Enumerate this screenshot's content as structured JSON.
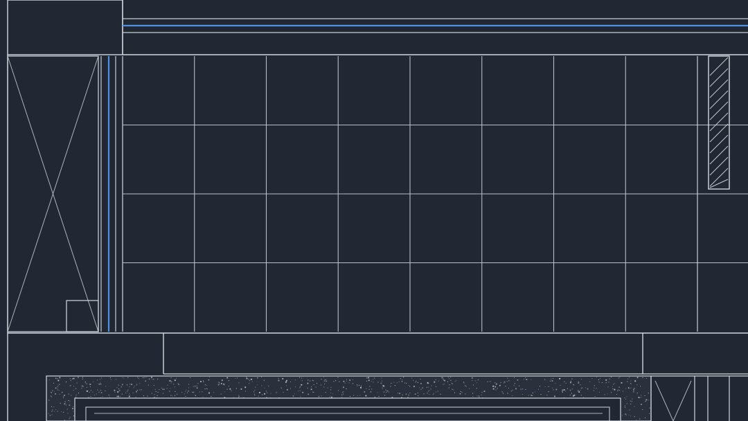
{
  "drawing": {
    "background_color": "#212833",
    "line_color": "#d4d8df",
    "grid_line_color": "#b9bec7",
    "accent_color": "#4d8fe0",
    "speckle_color": "#c9ced6",
    "grid": {
      "columns": 8,
      "rows": 4
    },
    "elements": [
      "floor-tile-grid",
      "wall-double-line",
      "blue-wall-band-top",
      "blue-wall-band-left",
      "elevator-shaft-cross",
      "hatched-column",
      "terrazzo-border",
      "door-openings"
    ]
  }
}
